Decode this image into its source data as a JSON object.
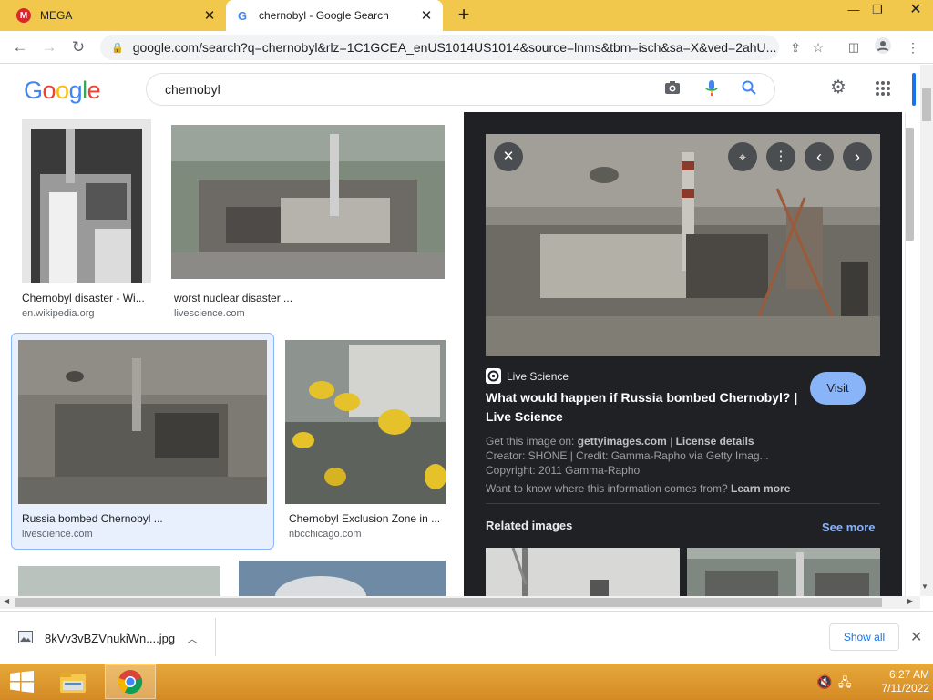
{
  "browser": {
    "tabs": [
      {
        "title": "MEGA",
        "icon": "mega-icon"
      },
      {
        "title": "chernobyl - Google Search",
        "icon": "google-favicon"
      }
    ],
    "url": "google.com/search?q=chernobyl&rlz=1C1GCEA_enUS1014US1014&source=lnms&tbm=isch&sa=X&ved=2ahU..."
  },
  "google": {
    "logo": [
      "G",
      "o",
      "o",
      "g",
      "l",
      "e"
    ],
    "logo_colors": [
      "#4285f4",
      "#ea4335",
      "#fbbc05",
      "#4285f4",
      "#34a853",
      "#ea4335"
    ],
    "query": "chernobyl"
  },
  "results": [
    {
      "title": "Chernobyl disaster - Wi...",
      "source": "en.wikipedia.org"
    },
    {
      "title": "worst nuclear disaster ...",
      "source": "livescience.com"
    },
    {
      "title": "Russia bombed Chernobyl ...",
      "source": "livescience.com"
    },
    {
      "title": "Chernobyl Exclusion Zone in ...",
      "source": "nbcchicago.com"
    }
  ],
  "preview": {
    "site_name": "Live Science",
    "title_line1": "What would happen if Russia bombed Chernobyl? |",
    "title_line2": "Live Science",
    "visit_label": "Visit",
    "get_image_prefix": "Get this image on: ",
    "get_image_site": "gettyimages.com",
    "separator": " | ",
    "license_label": "License details",
    "creator": "Creator: SHONE | Credit: Gamma-Rapho via Getty Imag...",
    "copyright": "Copyright: 2011 Gamma-Rapho",
    "info_question": "Want to know where this information comes from?",
    "learn_more": "Learn more",
    "related_label": "Related images",
    "see_more": "See more"
  },
  "downloads": {
    "file_name": "8kVv3vBZVnukiWn....jpg",
    "show_all": "Show all"
  },
  "taskbar": {
    "time": "6:27 AM",
    "date": "7/11/2022"
  },
  "colors": {
    "tab_strip": "#f1c84c",
    "visit_button": "#8ab4f8",
    "link_blue": "#8ab4f8",
    "pane_bg": "#202124"
  }
}
